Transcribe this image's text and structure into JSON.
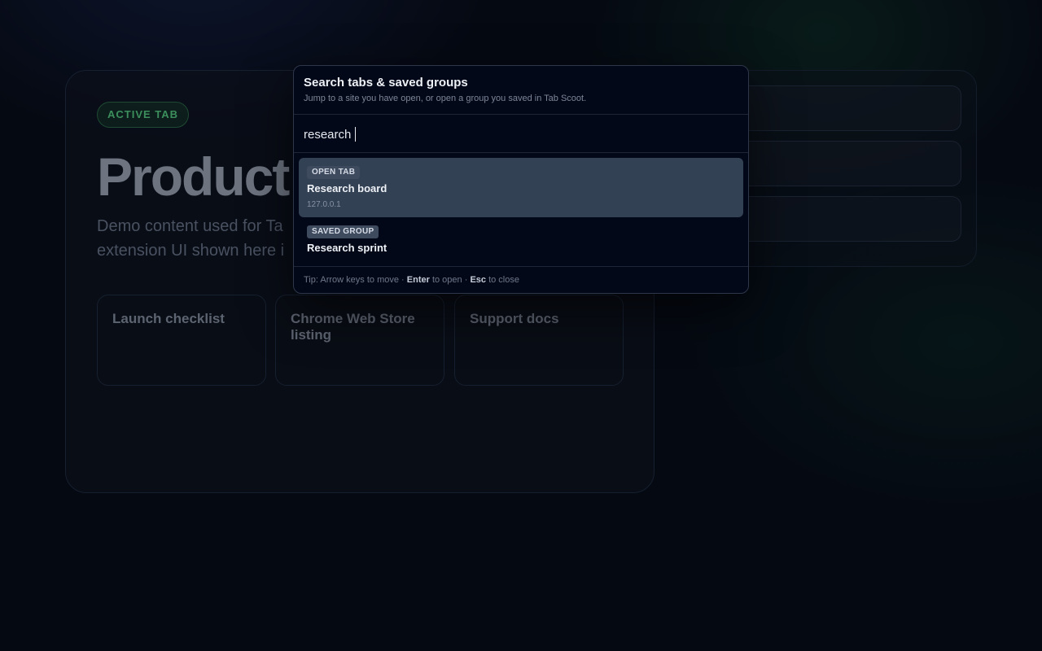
{
  "background_page": {
    "active_badge": "ACTIVE TAB",
    "hero_title": "Product r",
    "hero_subtitle_line1": "Demo content used for Ta",
    "hero_subtitle_line2": "extension UI shown here i",
    "cards": [
      {
        "title": "Launch checklist"
      },
      {
        "title": "Chrome Web Store listing"
      },
      {
        "title": "Support docs"
      }
    ]
  },
  "palette": {
    "title": "Search tabs & saved groups",
    "description": "Jump to a site you have open, or open a group you saved in Tab Scoot.",
    "search_value": "research",
    "results": [
      {
        "tag": "OPEN TAB",
        "title": "Research board",
        "url": "127.0.0.1",
        "selected": true
      },
      {
        "tag": "SAVED GROUP",
        "title": "Research sprint",
        "selected": false
      }
    ],
    "footer": {
      "tip_label": "Tip:",
      "arrow_text": "Arrow keys to move ·",
      "enter_key": "Enter",
      "enter_text": "to open ·",
      "esc_key": "Esc",
      "esc_text": "to close"
    }
  },
  "colors": {
    "accent_green": "#3c8f5d",
    "selected_row": "#334155",
    "palette_bg": "#030818"
  }
}
